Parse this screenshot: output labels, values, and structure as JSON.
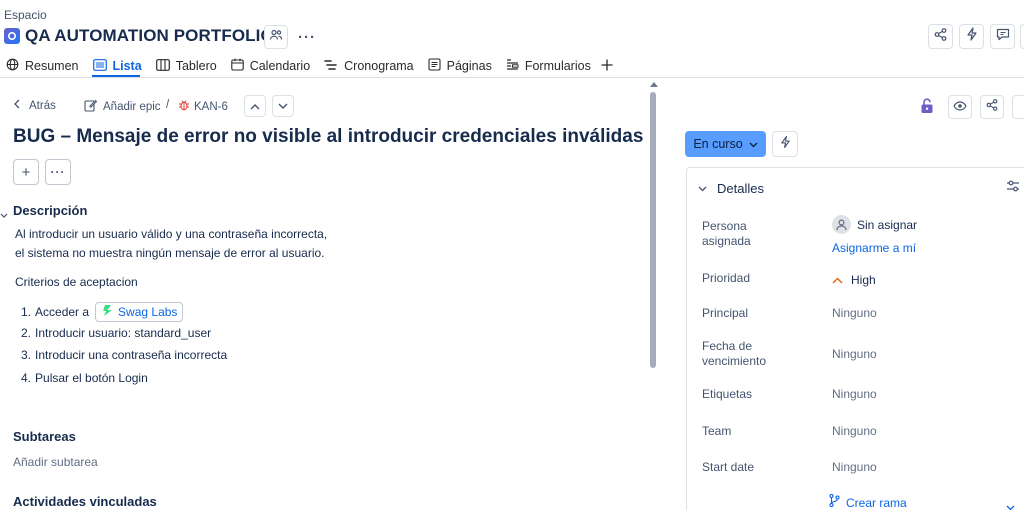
{
  "header": {
    "space_label": "Espacio",
    "project_title": "QA AUTOMATION PORTFOLIO",
    "more_label": "···"
  },
  "tabs": [
    {
      "label": "Resumen",
      "icon": "globe-icon"
    },
    {
      "label": "Lista",
      "icon": "list-icon",
      "active": true
    },
    {
      "label": "Tablero",
      "icon": "board-icon"
    },
    {
      "label": "Calendario",
      "icon": "calendar-icon"
    },
    {
      "label": "Cronograma",
      "icon": "timeline-icon"
    },
    {
      "label": "Páginas",
      "icon": "pages-icon"
    },
    {
      "label": "Formularios",
      "icon": "forms-icon"
    }
  ],
  "breadcrumb": {
    "back": "Atrás",
    "add_epic": "Añadir epic",
    "separator": "/",
    "issue_key": "KAN-6"
  },
  "issue": {
    "title": "BUG – Mensaje de error no visible al introducir credenciales inválidas",
    "add_label": "+",
    "more_label": "···"
  },
  "description": {
    "heading": "Descripción",
    "line1": "Al introducir un usuario válido y una contraseña incorrecta,",
    "line2": "el sistema no muestra ningún mensaje de error al usuario.",
    "criteria_heading": "Criterios de aceptacion",
    "steps": [
      {
        "num": "1.",
        "text": "Acceder a",
        "link": "Swag Labs"
      },
      {
        "num": "2.",
        "text": "Introducir usuario: standard_user"
      },
      {
        "num": "3.",
        "text": "Introducir una contraseña incorrecta"
      },
      {
        "num": "4.",
        "text": "Pulsar el botón Login"
      }
    ]
  },
  "subtasks": {
    "heading": "Subtareas",
    "add": "Añadir subtarea"
  },
  "linked": {
    "heading": "Actividades vinculadas"
  },
  "status": {
    "label": "En curso"
  },
  "details": {
    "heading": "Detalles",
    "assignee_label": "Persona asignada",
    "assignee_label_l1": "Persona",
    "assignee_label_l2": "asignada",
    "assignee_value": "Sin asignar",
    "assign_me": "Asignarme a mí",
    "priority_label": "Prioridad",
    "priority_value": "High",
    "parent_label": "Principal",
    "parent_value": "Ninguno",
    "due_label_l1": "Fecha de",
    "due_label_l2": "vencimiento",
    "due_value": "Ninguno",
    "labels_label": "Etiquetas",
    "labels_value": "Ninguno",
    "team_label": "Team",
    "team_value": "Ninguno",
    "start_label": "Start date",
    "start_value": "Ninguno",
    "create_branch": "Crear rama"
  },
  "colors": {
    "accent": "#0c66e4",
    "status_bg": "#579dff",
    "priority_high": "#e56910",
    "bug_red": "#e2483d",
    "lock_purple": "#6e5dc6"
  }
}
